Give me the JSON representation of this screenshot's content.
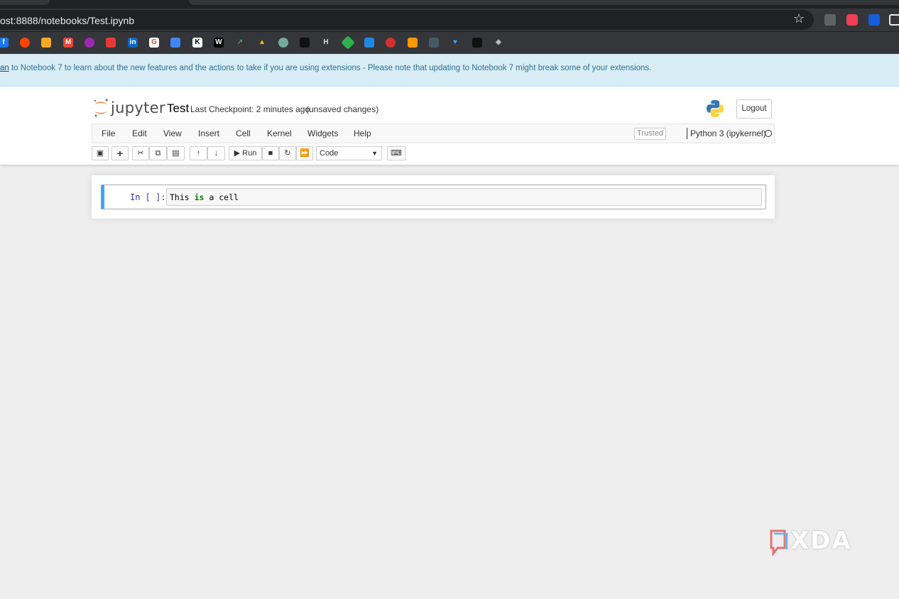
{
  "browser": {
    "url": "ost:8888/notebooks/Test.ipynb",
    "bookmarks": [
      "facebook",
      "reddit",
      "charts",
      "gmail",
      "onion",
      "store",
      "linkedin",
      "google",
      "docs",
      "jira",
      "W",
      "arrow",
      "drive",
      "chatgpt",
      "perplexity",
      "H",
      "feedly",
      "chat",
      "red",
      "box",
      "terminal",
      "heart",
      "stocks",
      "layers"
    ]
  },
  "banner": {
    "link_text": "an",
    "message": " to Notebook 7 to learn about the new features and the actions to take if you are using extensions - Please note that updating to Notebook 7 might break some of your extensions."
  },
  "header": {
    "logo_text": "jupyter",
    "notebook_name": "Test",
    "checkpoint": "Last Checkpoint: 2 minutes ago",
    "save_status": "(unsaved changes)",
    "logout_label": "Logout"
  },
  "menu": {
    "items": [
      "File",
      "Edit",
      "View",
      "Insert",
      "Cell",
      "Kernel",
      "Widgets",
      "Help"
    ],
    "trusted_label": "Trusted",
    "kernel_name": "Python 3 (ipykernel)"
  },
  "toolbar": {
    "run_label": "Run",
    "cell_type": "Code"
  },
  "cell": {
    "prompt": "In [ ]:",
    "code": "This is a cell"
  },
  "watermark": {
    "text": "XDA"
  },
  "colors": {
    "accent_blue": "#42a5f5",
    "banner_bg": "#d9edf7",
    "jupyter_orange": "#f37726"
  }
}
